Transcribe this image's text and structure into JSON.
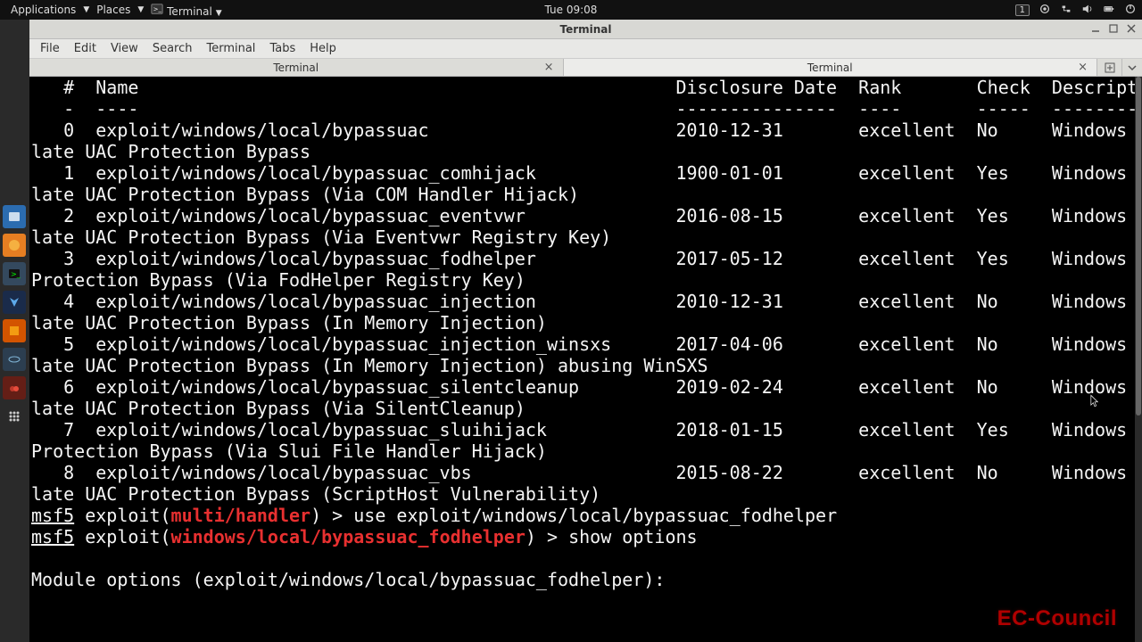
{
  "topbar": {
    "applications": "Applications",
    "places": "Places",
    "active_app": "Terminal",
    "clock": "Tue 09:08",
    "workspace_badge": "1"
  },
  "window": {
    "title": "Terminal"
  },
  "menu": {
    "file": "File",
    "edit": "Edit",
    "view": "View",
    "search": "Search",
    "terminal": "Terminal",
    "tabs": "Tabs",
    "help": "Help"
  },
  "tabs": {
    "t1": "Terminal",
    "t2": "Terminal"
  },
  "cols": {
    "idx_col": 3,
    "name_col": 6,
    "disc_col": 60,
    "rank_col": 77,
    "check_col": 88,
    "desc_col": 95
  },
  "header": {
    "idx": "#",
    "name": "Name",
    "disc": "Disclosure Date",
    "rank": "Rank",
    "check": "Check",
    "desc": "Description"
  },
  "divider": {
    "idx": "-",
    "name": "----",
    "disc": "---------------",
    "rank": "----",
    "check": "-----",
    "desc": "-----------"
  },
  "results": [
    {
      "idx": "0",
      "name": "exploit/windows/local/bypassuac",
      "disc": "2010-12-31",
      "rank": "excellent",
      "check": "No",
      "desc": "Windows Esca",
      "wrap": "late UAC Protection Bypass"
    },
    {
      "idx": "1",
      "name": "exploit/windows/local/bypassuac_comhijack",
      "disc": "1900-01-01",
      "rank": "excellent",
      "check": "Yes",
      "desc": "Windows Esca",
      "wrap": "late UAC Protection Bypass (Via COM Handler Hijack)"
    },
    {
      "idx": "2",
      "name": "exploit/windows/local/bypassuac_eventvwr",
      "disc": "2016-08-15",
      "rank": "excellent",
      "check": "Yes",
      "desc": "Windows Esca",
      "wrap": "late UAC Protection Bypass (Via Eventvwr Registry Key)"
    },
    {
      "idx": "3",
      "name": "exploit/windows/local/bypassuac_fodhelper",
      "disc": "2017-05-12",
      "rank": "excellent",
      "check": "Yes",
      "desc": "Windows UAC",
      "wrap": "Protection Bypass (Via FodHelper Registry Key)"
    },
    {
      "idx": "4",
      "name": "exploit/windows/local/bypassuac_injection",
      "disc": "2010-12-31",
      "rank": "excellent",
      "check": "No",
      "desc": "Windows Esca",
      "wrap": "late UAC Protection Bypass (In Memory Injection)"
    },
    {
      "idx": "5",
      "name": "exploit/windows/local/bypassuac_injection_winsxs",
      "disc": "2017-04-06",
      "rank": "excellent",
      "check": "No",
      "desc": "Windows Esca",
      "wrap": "late UAC Protection Bypass (In Memory Injection) abusing WinSXS"
    },
    {
      "idx": "6",
      "name": "exploit/windows/local/bypassuac_silentcleanup",
      "disc": "2019-02-24",
      "rank": "excellent",
      "check": "No",
      "desc": "Windows Esca",
      "wrap": "late UAC Protection Bypass (Via SilentCleanup)"
    },
    {
      "idx": "7",
      "name": "exploit/windows/local/bypassuac_sluihijack",
      "disc": "2018-01-15",
      "rank": "excellent",
      "check": "Yes",
      "desc": "Windows UAC",
      "wrap": "Protection Bypass (Via Slui File Handler Hijack)"
    },
    {
      "idx": "8",
      "name": "exploit/windows/local/bypassuac_vbs",
      "disc": "2015-08-22",
      "rank": "excellent",
      "check": "No",
      "desc": "Windows Esca",
      "wrap": "late UAC Protection Bypass (ScriptHost Vulnerability)"
    }
  ],
  "prompt": {
    "p1_pre": "msf5",
    "p1_mid": " exploit(",
    "p1_ctx": "multi/handler",
    "p1_post": ") > ",
    "p1_cmd": "use exploit/windows/local/bypassuac_fodhelper",
    "p2_pre": "msf5",
    "p2_mid": " exploit(",
    "p2_ctx": "windows/local/bypassuac_fodhelper",
    "p2_post": ") > ",
    "p2_cmd": "show options",
    "mod_line": "Module options (exploit/windows/local/bypassuac_fodhelper):"
  },
  "watermark": "EC-Council"
}
